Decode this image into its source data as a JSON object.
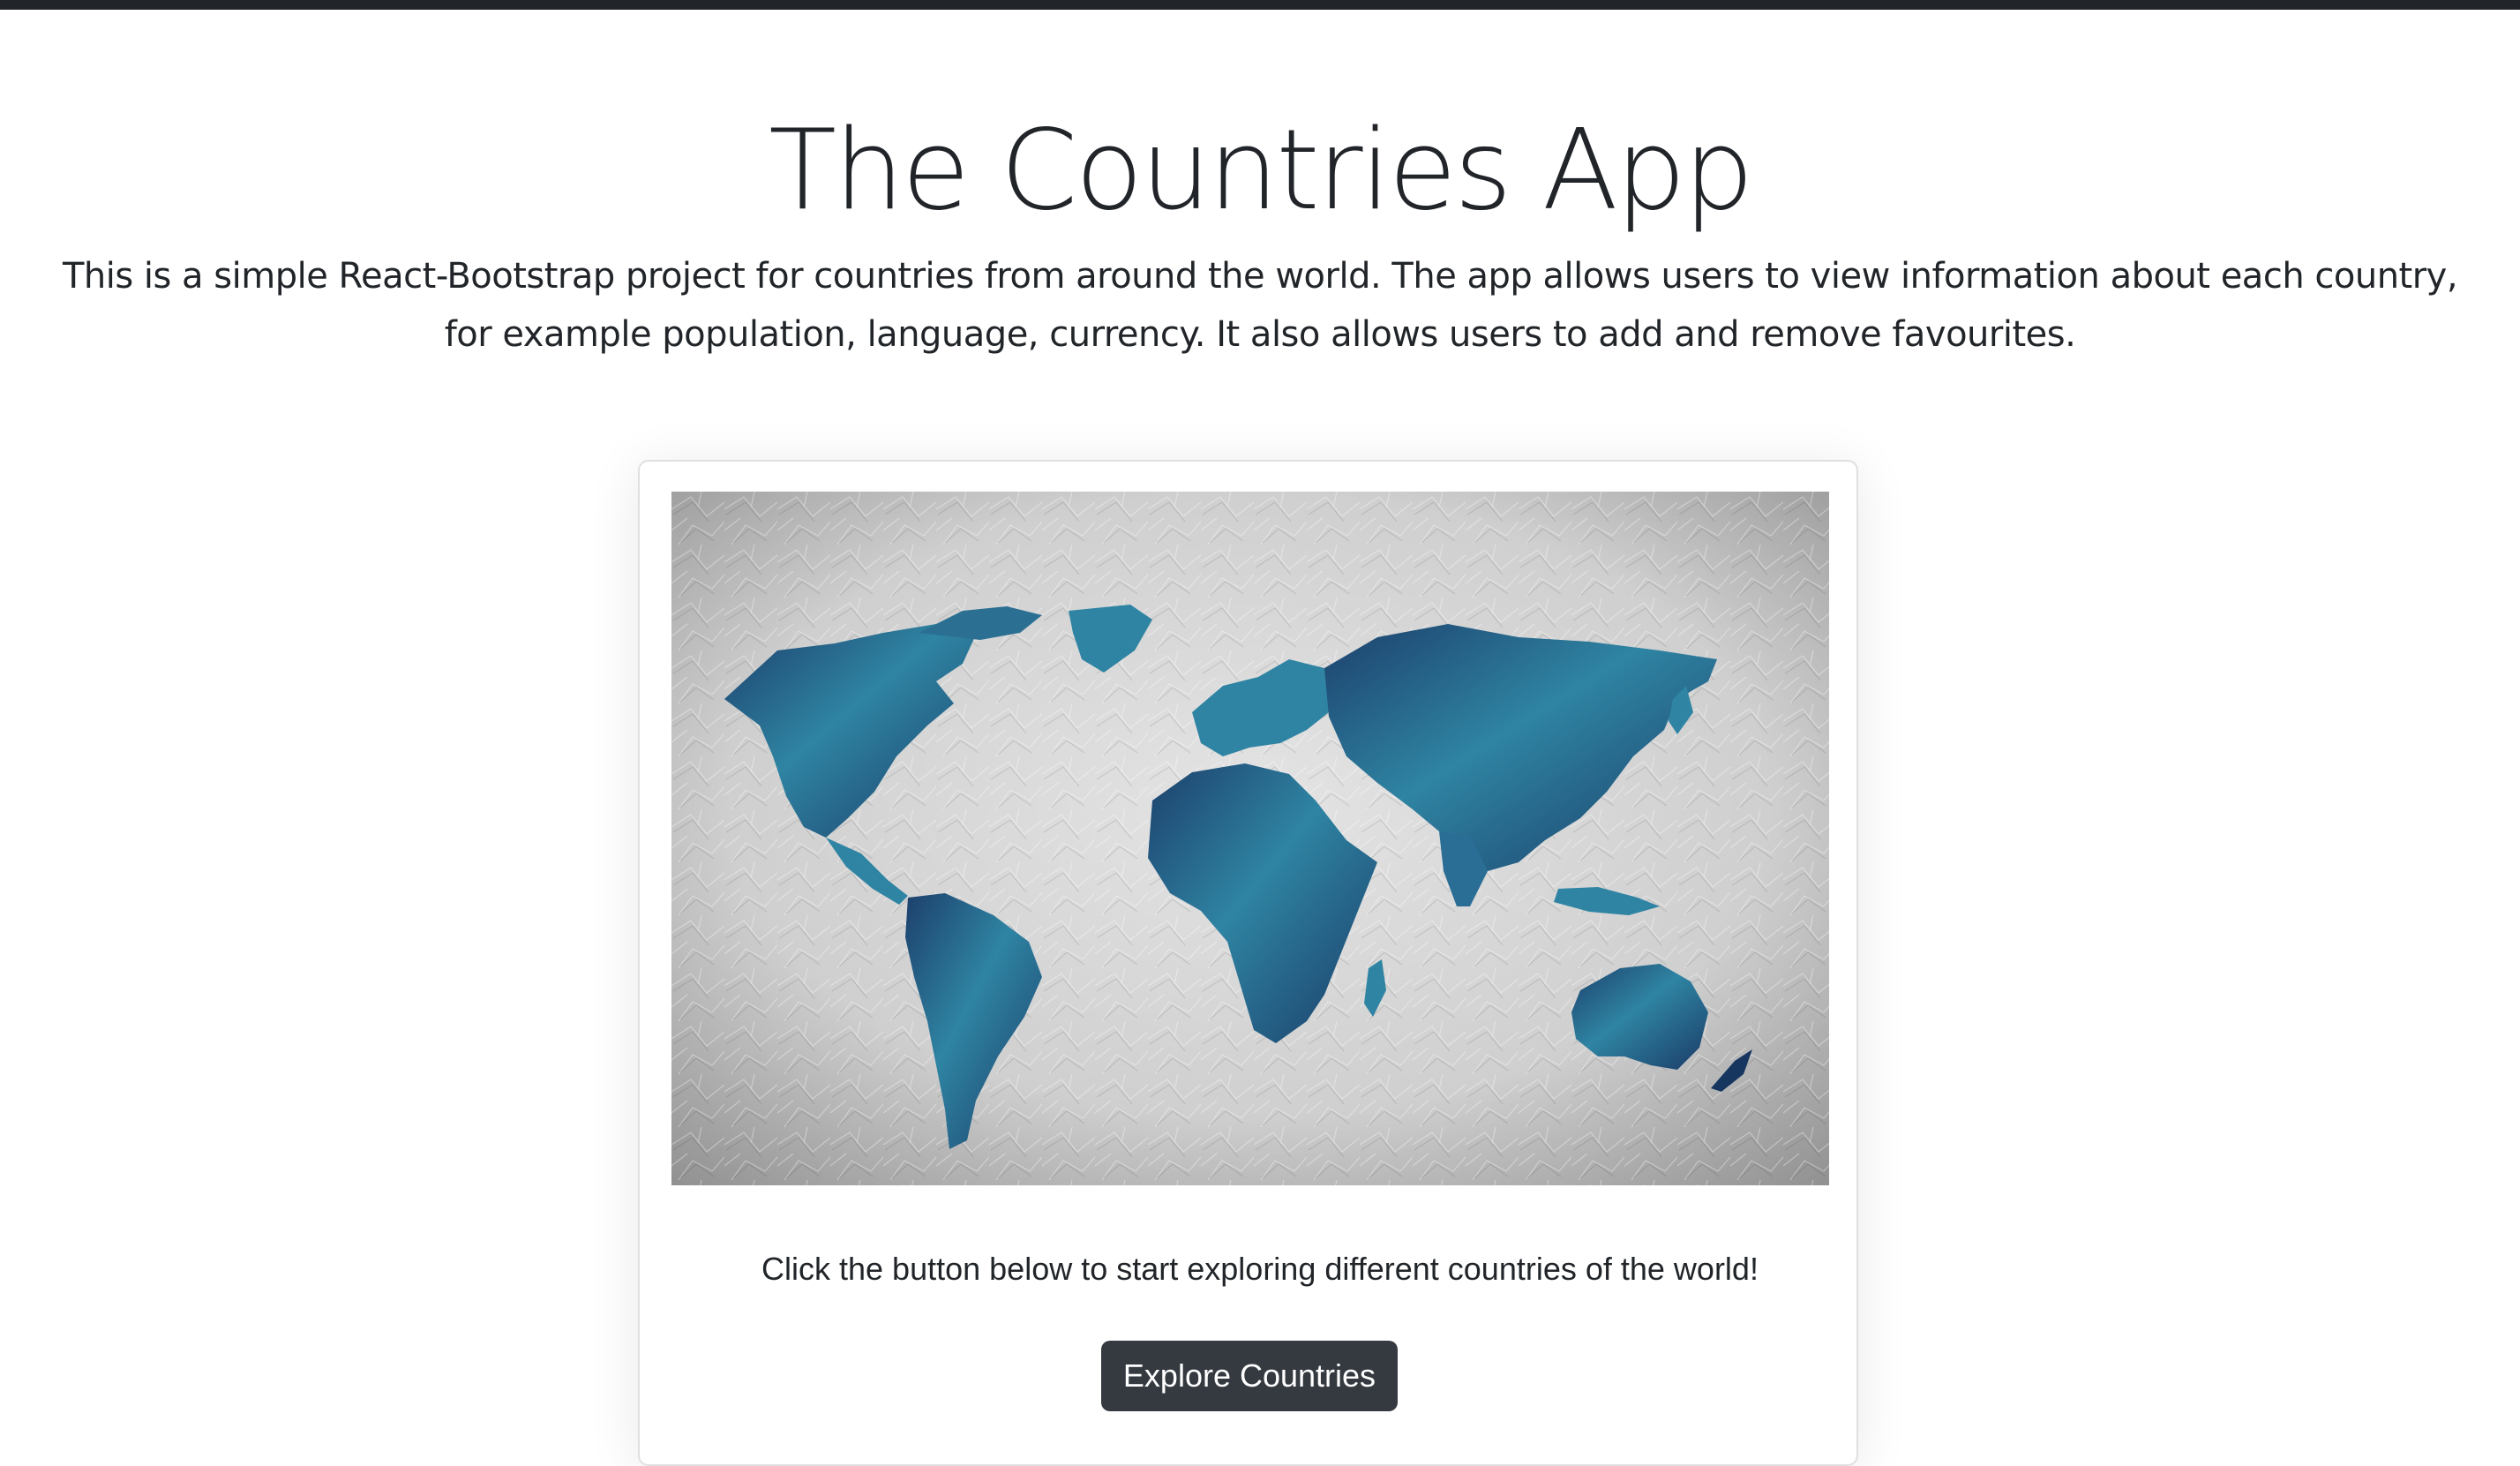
{
  "header": {
    "title": "The Countries App",
    "intro": "This is a simple React-Bootstrap project for countries from around the world. The app allows users to view information about each country, for example population, language, currency. It also allows users to add and remove favourites."
  },
  "card": {
    "image_subject": "world map in blue on crumpled grey paper",
    "text": "Click the button below to start exploring different countries of the world!",
    "button_label": "Explore Countries"
  },
  "colors": {
    "top_bar": "#212529",
    "text": "#212529",
    "button_bg": "#343a40",
    "button_text": "#ffffff",
    "map_land": "#2f7f9c",
    "map_land_dark": "#17365f",
    "paper": "#d3d3d3"
  }
}
